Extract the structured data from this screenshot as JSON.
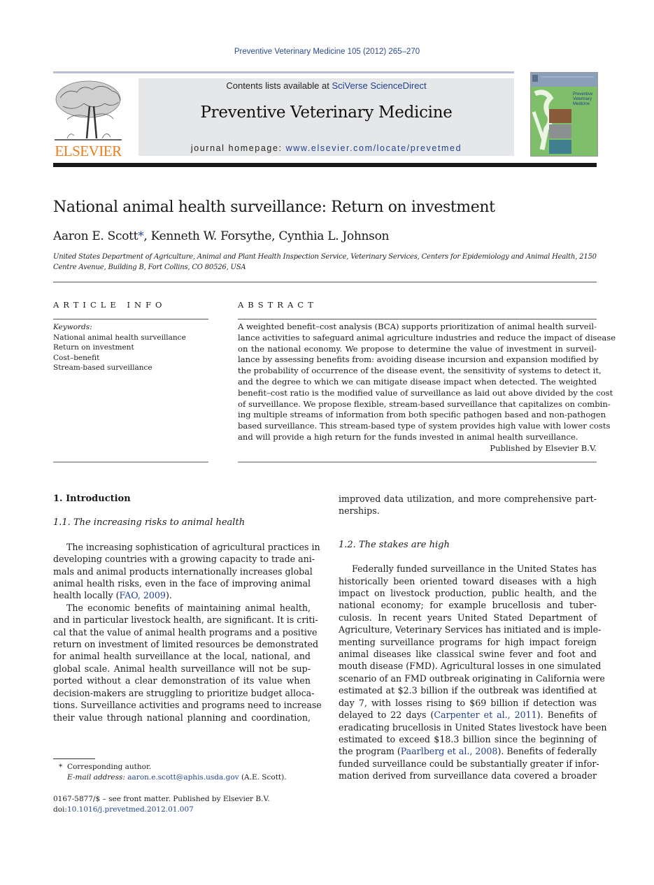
{
  "header": {
    "running_head": "Preventive Veterinary Medicine 105 (2012) 265–270",
    "publisher_logo_text": "ELSEVIER",
    "contents_prefix": "Contents lists available at ",
    "contents_link": "SciVerse ScienceDirect",
    "journal_title": "Preventive Veterinary Medicine",
    "homepage_prefix": "journal homepage: ",
    "homepage_link": "www.elsevier.com/locate/prevetmed",
    "cover_title_lines": [
      "Preventive",
      "Veterinary",
      "Medicine"
    ]
  },
  "colors": {
    "link": "#1f3f8f",
    "elsevier_orange": "#f07b1a",
    "banner_gray": "#e6e7e8",
    "cover_green": "#7fbf6a"
  },
  "article": {
    "title": "National animal health surveillance: Return on investment",
    "authors": [
      {
        "name": "Aaron E. Scott",
        "mark": "*"
      },
      {
        "name": "Kenneth W. Forsythe",
        "mark": ""
      },
      {
        "name": "Cynthia L. Johnson",
        "mark": ""
      }
    ],
    "affiliation_lines": [
      "United States Department of Agriculture, Animal and Plant Health Inspection Service, Veterinary Services, Centers for Epidemiology and Animal Health, 2150",
      "Centre Avenue, Building B, Fort Collins, CO 80526, USA"
    ]
  },
  "article_info": {
    "heading": "ARTICLE INFO",
    "keywords_label": "Keywords:",
    "keywords": [
      "National animal health surveillance",
      "Return on investment",
      "Cost–benefit",
      "Stream-based surveillance"
    ]
  },
  "abstract": {
    "heading": "ABSTRACT",
    "lines": [
      "A weighted benefit–cost analysis (BCA) supports prioritization of animal health surveil-",
      "lance activities to safeguard animal agriculture industries and reduce the impact of disease",
      "on the national economy. We propose to determine the value of investment in surveil-",
      "lance by assessing benefits from: avoiding disease incursion and expansion modified by",
      "the probability of occurrence of the disease event, the sensitivity of systems to detect it,",
      "and the degree to which we can mitigate disease impact when detected. The weighted",
      "benefit–cost ratio is the modified value of surveillance as laid out above divided by the cost",
      "of surveillance. We propose flexible, stream-based surveillance that capitalizes on combin-",
      "ing multiple streams of information from both specific pathogen based and non-pathogen",
      "based surveillance. This stream-based type of system provides high value with lower costs",
      "and will provide a high return for the funds invested in animal health surveillance."
    ],
    "published_by": "Published by Elsevier B.V."
  },
  "body": {
    "section1_heading": "1.  Introduction",
    "section1_1_heading": "1.1.  The increasing risks to animal health",
    "para1_lines": [
      "The increasing sophistication of agricultural practices in",
      "developing countries with a growing capacity to trade ani-",
      "mals and animal products internationally increases global",
      "animal health risks, even in the face of improving animal"
    ],
    "para1_last_prefix": "health locally (",
    "para1_citation": "FAO, 2009",
    "para1_last_suffix": ").",
    "para2_lines": [
      "The economic benefits of maintaining animal health,",
      "and in particular livestock health, are significant. It is criti-",
      "cal that the value of animal health programs and a positive",
      "return on investment of limited resources be demonstrated",
      "for animal health surveillance at the local, national, and",
      "global scale. Animal health surveillance will not be sup-",
      "ported without a clear demonstration of its value when",
      "decision-makers are struggling to prioritize budget alloca-",
      "tions. Surveillance activities and programs need to increase",
      "their value through national planning and coordination,"
    ],
    "right_cont_lines": [
      "improved data utilization, and more comprehensive part-",
      "nerships."
    ],
    "section1_2_heading": "1.2.  The stakes are high",
    "para3_lines": [
      "Federally funded surveillance in the United States has",
      "historically been oriented toward diseases with a high",
      "impact on livestock production, public health, and the",
      "national economy; for example brucellosis and tuber-",
      "culosis. In recent years United Stated Department of",
      "Agriculture, Veterinary Services has initiated and is imple-",
      "menting surveillance programs for high impact foreign",
      "animal diseases like classical swine fever and foot and",
      "mouth disease (FMD). Agricultural losses in one simulated",
      "scenario of an FMD outbreak originating in California were",
      "estimated at $2.3 billion if the outbreak was identified at",
      "day 7, with losses rising to $69 billion if detection was"
    ],
    "para3_cite1_prefix": "delayed to 22 days (",
    "para3_cite1": "Carpenter et al., 2011",
    "para3_cite1_suffix": "). Benefits of",
    "para3_mid_lines": [
      "eradicating brucellosis in United States livestock have been",
      "estimated to exceed $18.3 billion since the beginning of"
    ],
    "para3_cite2_prefix": "the program (",
    "para3_cite2": "Paarlberg et al., 2008",
    "para3_cite2_suffix": "). Benefits of federally",
    "para3_end_lines": [
      "funded surveillance could be substantially greater if infor-",
      "mation derived from surveillance data covered a broader"
    ]
  },
  "footnotes": {
    "corresponding_mark": "*",
    "corresponding_text": "Corresponding author.",
    "email_label": "E-mail address: ",
    "email": "aaron.e.scott@aphis.usda.gov",
    "email_suffix": " (A.E. Scott).",
    "front_matter": "0167-5877/$ – see front matter. Published by Elsevier B.V.",
    "doi_label": "doi:",
    "doi": "10.1016/j.prevetmed.2012.01.007"
  }
}
